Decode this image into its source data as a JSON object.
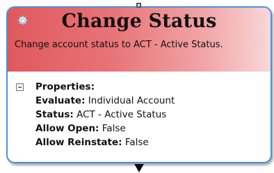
{
  "node": {
    "title": "Change Status",
    "description": "Change account status to ACT - Active Status.",
    "properties_header": "Properties:",
    "properties": [
      {
        "key": "Evaluate:",
        "value": "Individual Account"
      },
      {
        "key": "Status:",
        "value": "ACT - Active Status"
      },
      {
        "key": "Allow Open:",
        "value": "False"
      },
      {
        "key": "Allow Reinstate:",
        "value": "False"
      }
    ],
    "icon": "gear-icon",
    "colors": {
      "header_start": "#e0585c",
      "header_end": "#f8d7d8",
      "border": "#4a90e2"
    }
  }
}
